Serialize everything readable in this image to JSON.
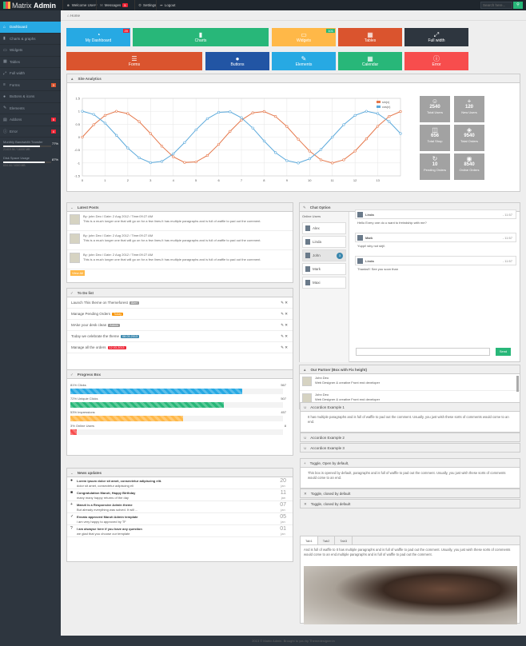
{
  "topbar": {
    "brand_light": "Matrix",
    "brand_bold": "Admin",
    "welcome": "Welcome User",
    "messages": "Messages",
    "messages_badge": "5",
    "settings": "Settings",
    "logout": "Logout",
    "search_placeholder": "Search here...",
    "search_icon": "search-icon"
  },
  "sidebar": {
    "items": [
      {
        "label": "Dashboard",
        "icon": "home-icon"
      },
      {
        "label": "Charts & graphs",
        "icon": "signal-icon"
      },
      {
        "label": "Widgets",
        "icon": "inbox-icon"
      },
      {
        "label": "Tables",
        "icon": "th-icon"
      },
      {
        "label": "Full width",
        "icon": "fullscreen-icon"
      },
      {
        "label": "Forms",
        "icon": "list-icon",
        "badge": "3"
      },
      {
        "label": "Buttons & icons",
        "icon": "tint-icon"
      },
      {
        "label": "Elements",
        "icon": "pencil-icon"
      },
      {
        "label": "Addons",
        "icon": "file-icon",
        "badge": "5"
      },
      {
        "label": "Error",
        "icon": "info-icon",
        "badge": "4"
      }
    ],
    "stats": [
      {
        "title": "Monthly Bandwidth Transfer",
        "pct": "77%",
        "sub": "21419.94 / 14000 MB",
        "fill": 0.77
      },
      {
        "title": "Disk Space Usage",
        "pct": "87%",
        "sub": "604.44 / 4000 MB",
        "fill": 0.87
      }
    ]
  },
  "breadcrumb": "Home",
  "quick_buttons": [
    {
      "label": "My Dashboard",
      "icon": "dashboard-icon",
      "color": "#27a9e3",
      "badge": "20"
    },
    {
      "label": "Charts",
      "icon": "signal-icon",
      "color": "#28b779"
    },
    {
      "label": "Widgets",
      "icon": "inbox-icon",
      "color": "#ffb848",
      "badge": "101"
    },
    {
      "label": "Tables",
      "icon": "th-icon",
      "color": "#da542e"
    },
    {
      "label": "Full width",
      "icon": "fullscreen-icon",
      "color": "#2e363f"
    },
    {
      "label": "Forms",
      "icon": "th-list-icon",
      "color": "#da542e"
    },
    {
      "label": "Buttons",
      "icon": "tint-icon",
      "color": "#2255a4"
    },
    {
      "label": "Elements",
      "icon": "pencil-icon",
      "color": "#27a9e3"
    },
    {
      "label": "Calendar",
      "icon": "calendar-icon",
      "color": "#28b779"
    },
    {
      "label": "Error",
      "icon": "info-sign-icon",
      "color": "#f74d4d"
    }
  ],
  "analytics": {
    "title": "Site Analytics",
    "stats": [
      {
        "value": "2540",
        "label": "Total Users",
        "icon": "user-icon"
      },
      {
        "value": "120",
        "label": "New Users",
        "icon": "plus-icon"
      },
      {
        "value": "656",
        "label": "Total Shop",
        "icon": "cart-icon"
      },
      {
        "value": "9540",
        "label": "Total Orders",
        "icon": "tag-icon"
      },
      {
        "value": "10",
        "label": "Pending Orders",
        "icon": "repeat-icon"
      },
      {
        "value": "8540",
        "label": "Online Orders",
        "icon": "globe-icon"
      }
    ]
  },
  "chart_data": {
    "type": "line",
    "series": [
      {
        "name": "sin(x)",
        "color": "#e5774a",
        "x": [
          0,
          0.5,
          1,
          1.5,
          2,
          2.5,
          3,
          3.5,
          4,
          4.5,
          5,
          5.5,
          6,
          6.5,
          7,
          7.5,
          8,
          8.5,
          9,
          9.5,
          10,
          10.5,
          11,
          11.5,
          12,
          12.5,
          13,
          13.5,
          14
        ],
        "values": [
          0,
          0.48,
          0.84,
          1.0,
          0.91,
          0.6,
          0.14,
          -0.35,
          -0.76,
          -0.98,
          -0.96,
          -0.71,
          -0.28,
          0.22,
          0.66,
          0.94,
          0.99,
          0.8,
          0.41,
          -0.08,
          -0.54,
          -0.88,
          -1.0,
          -0.88,
          -0.54,
          -0.07,
          0.42,
          0.8,
          0.99
        ]
      },
      {
        "name": "cos(x)",
        "color": "#5ba9db",
        "x": [
          0,
          0.5,
          1,
          1.5,
          2,
          2.5,
          3,
          3.5,
          4,
          4.5,
          5,
          5.5,
          6,
          6.5,
          7,
          7.5,
          8,
          8.5,
          9,
          9.5,
          10,
          10.5,
          11,
          11.5,
          12,
          12.5,
          13,
          13.5,
          14
        ],
        "values": [
          1.0,
          0.88,
          0.54,
          0.07,
          -0.42,
          -0.8,
          -0.99,
          -0.94,
          -0.65,
          -0.21,
          0.28,
          0.71,
          0.96,
          0.98,
          0.75,
          0.35,
          -0.15,
          -0.6,
          -0.91,
          -1.0,
          -0.84,
          -0.48,
          0.0,
          0.48,
          0.84,
          1.0,
          0.91,
          0.6,
          0.14
        ]
      }
    ],
    "x_ticks": [
      "0",
      "1",
      "2",
      "3",
      "4",
      "5",
      "6",
      "7",
      "8",
      "9",
      "10",
      "11",
      "12",
      "13"
    ],
    "y_ticks": [
      "1.5",
      "1",
      "0.5",
      "0",
      "-0.5",
      "-1",
      "-1.5"
    ],
    "xlim": [
      0,
      14
    ],
    "ylim": [
      -1.5,
      1.5
    ],
    "grid": true,
    "legend": "top-right"
  },
  "latest_posts": {
    "title": "Latest Posts",
    "posts": [
      {
        "meta": "By: john Deo / Date: 2 Aug 2012 / Time:09:27 AM",
        "text": "This is a much longer one that will go on for a few lines.It has multiple paragraphs and is full of waffle to pad out the comment."
      },
      {
        "meta": "By: john Deo / Date: 2 Aug 2012 / Time:09:27 AM",
        "text": "This is a much longer one that will go on for a few lines.It has multiple paragraphs and is full of waffle to pad out the comment."
      },
      {
        "meta": "By: john Deo / Date: 2 Aug 2012 / Time:09:27 AM",
        "text": "This is a much longer one that will go on for a few lines.It has multiple paragraphs and is full of waffle to pad out the comment."
      }
    ],
    "view_all": "View All"
  },
  "todo": {
    "title": "To Do list",
    "items": [
      {
        "text": "Launch This theme on Themeforest",
        "tag": "Alert",
        "color": "#999"
      },
      {
        "text": "Manage Pending Orders",
        "tag": "Today",
        "color": "#f89406"
      },
      {
        "text": "MAke your desk clean",
        "tag": "Admin",
        "color": "#999"
      },
      {
        "text": "Today we celebrate the theme",
        "tag": "08.03.2013",
        "color": "#3a87ad"
      },
      {
        "text": "Manage all the orders",
        "tag": "12.03.2013",
        "color": "#e23"
      }
    ]
  },
  "progress": {
    "title": "Progress Box",
    "items": [
      {
        "label": "81% Clicks",
        "value": "567",
        "pct": 0.81,
        "color": "#27a9e3"
      },
      {
        "label": "72% Uniquie Clicks",
        "value": "507",
        "pct": 0.72,
        "color": "#28b779"
      },
      {
        "label": "53% Impressions",
        "value": "457",
        "pct": 0.53,
        "color": "#ffb848"
      },
      {
        "label": "3% Online Users",
        "value": "8",
        "pct": 0.03,
        "color": "#f74d4d"
      }
    ]
  },
  "news": {
    "title": "News updates",
    "items": [
      {
        "title": "Lorem ipsum dolor sit amet, consectetur adipiscing elit.",
        "text": "dolor sit amet, consectetur adipiscing eli",
        "day": "20",
        "month": "jan",
        "icon": "dot-icon"
      },
      {
        "title": "Congratulation Maruti, Happy Birthday",
        "text": "many many happy returns of the day",
        "day": "11",
        "month": "jan",
        "icon": "gift-icon"
      },
      {
        "title": "Maruti is a Responsive Admin theme",
        "text": "But already everything was solved. It will ...",
        "day": "07",
        "month": "jan",
        "icon": "plus-icon"
      },
      {
        "title": "Envato approved Maruti Admin template",
        "text": "i am very happy to approved by TF",
        "day": "05",
        "month": "jan",
        "icon": "check-icon"
      },
      {
        "title": "I am alwayse here if you have any question",
        "text": "we glad that you choose our template",
        "day": "01",
        "month": "jan",
        "icon": "question-icon"
      }
    ]
  },
  "chat": {
    "title": "Chat Option",
    "online_title": "Online Users",
    "users": [
      {
        "name": "Alex"
      },
      {
        "name": "Linda"
      },
      {
        "name": "John",
        "badge": "3",
        "active": true
      },
      {
        "name": "Mark"
      },
      {
        "name": "Maxi"
      }
    ],
    "messages": [
      {
        "name": "Linda",
        "time": "- 11:57",
        "text": "Hello Every one do u want to freindship with me?"
      },
      {
        "name": "Mark",
        "time": "- 11:57",
        "text": "Yuppi! why not sirji!."
      },
      {
        "name": "Linda",
        "time": "- 11:57",
        "text": "Thanks!!! See you soon than"
      }
    ],
    "send": "Send"
  },
  "partner": {
    "title": "Our Partner (Box with Fix height)",
    "entries": [
      {
        "name": "John Deo",
        "role": "Web Designer & creative Front end developer"
      },
      {
        "name": "John Deo",
        "role": "Web Designer & creative Front end developer"
      }
    ]
  },
  "accordion": {
    "items": [
      "Accordion Example 1",
      "Accordion Example 2",
      "Accordion Example 3"
    ],
    "body": "It has multiple paragraphs and is full of waffle to pad out the comment. Usually, you just wish these sorts of comments would come to an end."
  },
  "toggle": {
    "open_title": "Toggle, Open by default,",
    "open_body": "This box is opened by default, paragraphs and is full of waffle to pad out the comment. Usually, you just wish these sorts of comments would come to an end.",
    "closed": [
      "Toggle, closed by default",
      "Toggle, closed by default"
    ]
  },
  "tabs": {
    "labels": [
      "Tab1",
      "Tab2",
      "Tab3"
    ],
    "body": "And is full of waffle to It has multiple paragraphs and is full of waffle to pad out the comment. Usually, you just wish these sorts of comments would come to an end.multiple paragraphs and is full of waffle to pad out the comment."
  },
  "footer": "2013 © Matrix Admin. Brought to you by Themedesigner.in"
}
